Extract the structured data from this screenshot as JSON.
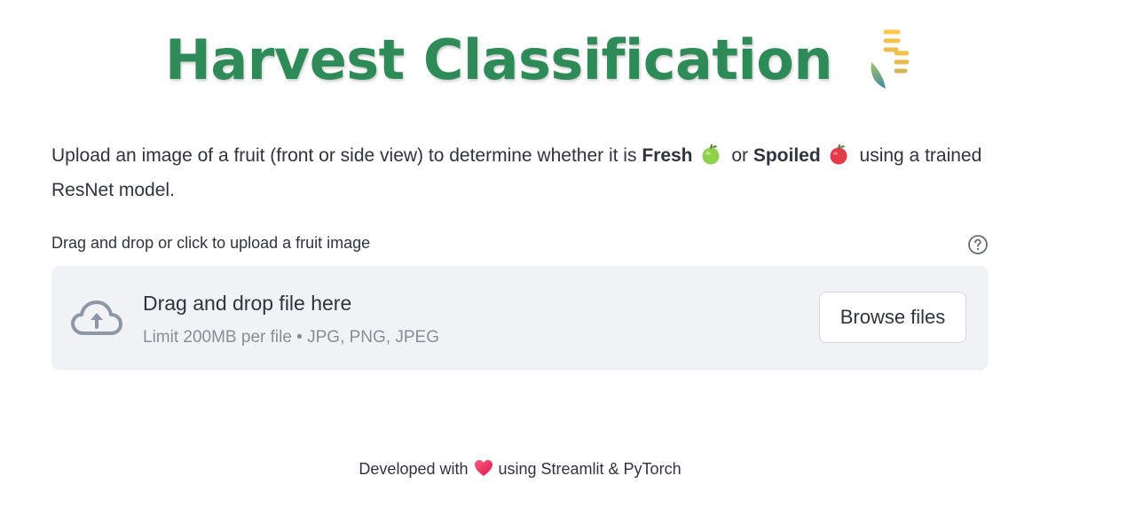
{
  "header": {
    "title": "Harvest Classification",
    "title_icon": "wheat-icon",
    "title_color": "#2e8b57"
  },
  "intro": {
    "text_before": "Upload an image of a fruit (front or side view) to determine whether it is ",
    "fresh_label": "Fresh",
    "fresh_icon": "green-apple-icon",
    "or_text": " or ",
    "spoiled_label": "Spoiled",
    "spoiled_icon": "red-apple-icon",
    "text_after": " using a trained ResNet model."
  },
  "uploader": {
    "label": "Drag and drop or click to upload a fruit image",
    "help_icon": "help-icon",
    "drop_title": "Drag and drop file here",
    "limit_text": "Limit 200MB per file • JPG, PNG, JPEG",
    "browse_label": "Browse files",
    "background": "#f0f2f6"
  },
  "footer": {
    "text_before": "Developed with",
    "heart_icon": "heart-icon",
    "text_after": "using Streamlit & PyTorch"
  }
}
